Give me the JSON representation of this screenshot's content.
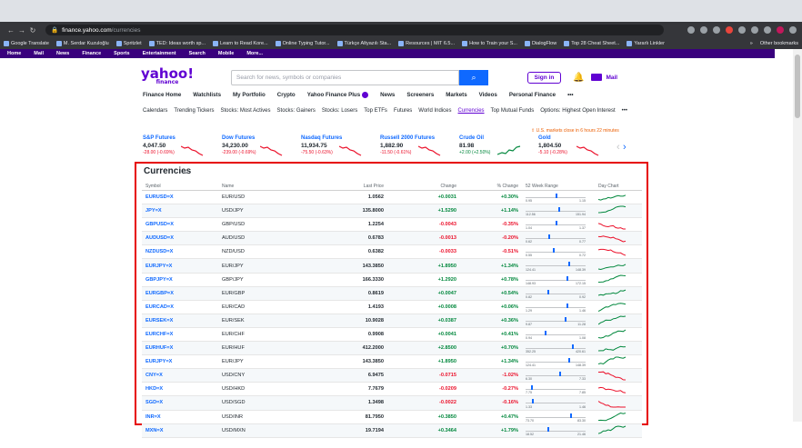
{
  "browser": {
    "url_host": "finance.yahoo.com",
    "url_path": "/currencies",
    "bookmarks": [
      "Google Translate",
      "M. Serdar Kuzuloğlu",
      "Spritzlet",
      "TED: Ideas worth sp...",
      "Learn to Read Kore...",
      "Online Typing Tutor...",
      "Türkçe Altyazılı Sta...",
      "Resources | MIT 6.5...",
      "How to Train your S...",
      "DialogFlow",
      "Top 28 Cheat Sheet...",
      "Yararlı Linkler"
    ],
    "bookmarks_right": [
      "»",
      "Other bookmarks"
    ]
  },
  "yahoo_nav": [
    "Home",
    "Mail",
    "News",
    "Finance",
    "Sports",
    "Entertainment",
    "Search",
    "Mobile",
    "More..."
  ],
  "header": {
    "logo": "yahoo!",
    "logo_sub": "finance",
    "search_placeholder": "Search for news, symbols or companies",
    "signin": "Sign in",
    "mail": "Mail"
  },
  "finance_nav": [
    "Finance Home",
    "Watchlists",
    "My Portfolio",
    "Crypto",
    "Yahoo Finance Plus",
    "News",
    "Screeners",
    "Markets",
    "Videos",
    "Personal Finance",
    "•••"
  ],
  "sub_nav": [
    "Calendars",
    "Trending Tickers",
    "Stocks: Most Actives",
    "Stocks: Gainers",
    "Stocks: Losers",
    "Top ETFs",
    "Futures",
    "World Indices",
    "Currencies",
    "Top Mutual Funds",
    "Options: Highest Open Interest",
    "•••"
  ],
  "market_note": "U.S. markets close in 6 hours 22 minutes",
  "tickers": [
    {
      "name": "S&P Futures",
      "price": "4,047.50",
      "change": "-28.00 (-0.69%)",
      "dir": "neg"
    },
    {
      "name": "Dow Futures",
      "price": "34,230.00",
      "change": "-239.00 (-0.69%)",
      "dir": "neg"
    },
    {
      "name": "Nasdaq Futures",
      "price": "11,934.75",
      "change": "-75.50 (-0.63%)",
      "dir": "neg"
    },
    {
      "name": "Russell 2000 Futures",
      "price": "1,882.90",
      "change": "-11.50 (-0.61%)",
      "dir": "neg"
    },
    {
      "name": "Crude Oil",
      "price": "81.98",
      "change": "+2.00 (+2.50%)",
      "dir": "pos"
    },
    {
      "name": "Gold",
      "price": "1,804.50",
      "change": "-5.10 (-0.28%)",
      "dir": "neg"
    }
  ],
  "currencies": {
    "title": "Currencies",
    "headers": [
      "Symbol",
      "Name",
      "Last Price",
      "Change",
      "% Change",
      "52 Week Range",
      "Day Chart"
    ],
    "rows": [
      {
        "symbol": "EURUSD=X",
        "name": "EUR/USD",
        "last": "1.0562",
        "change": "+0.0031",
        "pct": "+0.30%",
        "lo": "0.95",
        "hi": "1.15",
        "pos": 0.55
      },
      {
        "symbol": "JPY=X",
        "name": "USD/JPY",
        "last": "135.8000",
        "change": "+1.5290",
        "pct": "+1.14%",
        "lo": "112.56",
        "hi": "151.94",
        "pos": 0.6
      },
      {
        "symbol": "GBPUSD=X",
        "name": "GBP/USD",
        "last": "1.2254",
        "change": "-0.0043",
        "pct": "-0.35%",
        "lo": "1.04",
        "hi": "1.37",
        "pos": 0.55
      },
      {
        "symbol": "AUDUSD=X",
        "name": "AUD/USD",
        "last": "0.6783",
        "change": "-0.0013",
        "pct": "-0.20%",
        "lo": "0.62",
        "hi": "0.77",
        "pos": 0.42
      },
      {
        "symbol": "NZDUSD=X",
        "name": "NZD/USD",
        "last": "0.6382",
        "change": "-0.0033",
        "pct": "-0.51%",
        "lo": "0.55",
        "hi": "0.72",
        "pos": 0.5
      },
      {
        "symbol": "EURJPY=X",
        "name": "EUR/JPY",
        "last": "143.3850",
        "change": "+1.8950",
        "pct": "+1.34%",
        "lo": "124.41",
        "hi": "148.39",
        "pos": 0.78
      },
      {
        "symbol": "GBPJPY=X",
        "name": "GBP/JPY",
        "last": "166.3330",
        "change": "+1.2920",
        "pct": "+0.78%",
        "lo": "148.93",
        "hi": "172.15",
        "pos": 0.75
      },
      {
        "symbol": "EURGBP=X",
        "name": "EUR/GBP",
        "last": "0.8619",
        "change": "+0.0047",
        "pct": "+0.54%",
        "lo": "0.82",
        "hi": "0.92",
        "pos": 0.4
      },
      {
        "symbol": "EURCAD=X",
        "name": "EUR/CAD",
        "last": "1.4193",
        "change": "+0.0008",
        "pct": "+0.06%",
        "lo": "1.29",
        "hi": "1.46",
        "pos": 0.75
      },
      {
        "symbol": "EURSEK=X",
        "name": "EUR/SEK",
        "last": "10.9028",
        "change": "+0.0387",
        "pct": "+0.36%",
        "lo": "9.87",
        "hi": "11.28",
        "pos": 0.72
      },
      {
        "symbol": "EURCHF=X",
        "name": "EUR/CHF",
        "last": "0.9908",
        "change": "+0.0041",
        "pct": "+0.41%",
        "lo": "0.94",
        "hi": "1.08",
        "pos": 0.35
      },
      {
        "symbol": "EURHUF=X",
        "name": "EUR/HUF",
        "last": "412.2000",
        "change": "+2.8500",
        "pct": "+0.70%",
        "lo": "352.25",
        "hi": "420.61",
        "pos": 0.85
      },
      {
        "symbol": "EURJPY=X",
        "name": "EUR/JPY",
        "last": "143.3850",
        "change": "+1.8950",
        "pct": "+1.34%",
        "lo": "124.41",
        "hi": "148.39",
        "pos": 0.78
      },
      {
        "symbol": "CNY=X",
        "name": "USD/CNY",
        "last": "6.9475",
        "change": "-0.0715",
        "pct": "-1.02%",
        "lo": "6.30",
        "hi": "7.33",
        "pos": 0.62
      },
      {
        "symbol": "HKD=X",
        "name": "USD/HKD",
        "last": "7.7679",
        "change": "-0.0209",
        "pct": "-0.27%",
        "lo": "7.75",
        "hi": "7.85",
        "pos": 0.1
      },
      {
        "symbol": "SGD=X",
        "name": "USD/SGD",
        "last": "1.3498",
        "change": "-0.0022",
        "pct": "-0.16%",
        "lo": "1.33",
        "hi": "1.46",
        "pos": 0.12
      },
      {
        "symbol": "INR=X",
        "name": "USD/INR",
        "last": "81.7950",
        "change": "+0.3850",
        "pct": "+0.47%",
        "lo": "73.70",
        "hi": "83.30",
        "pos": 0.82
      },
      {
        "symbol": "MXN=X",
        "name": "USD/MXN",
        "last": "19.7194",
        "change": "+0.3464",
        "pct": "+1.79%",
        "lo": "18.52",
        "hi": "21.46",
        "pos": 0.4
      }
    ]
  },
  "colors": {
    "brand": "#6001d2",
    "up": "#00873c",
    "down": "#eb0f29",
    "link": "#0f69ff",
    "highlight": "#e60000"
  }
}
